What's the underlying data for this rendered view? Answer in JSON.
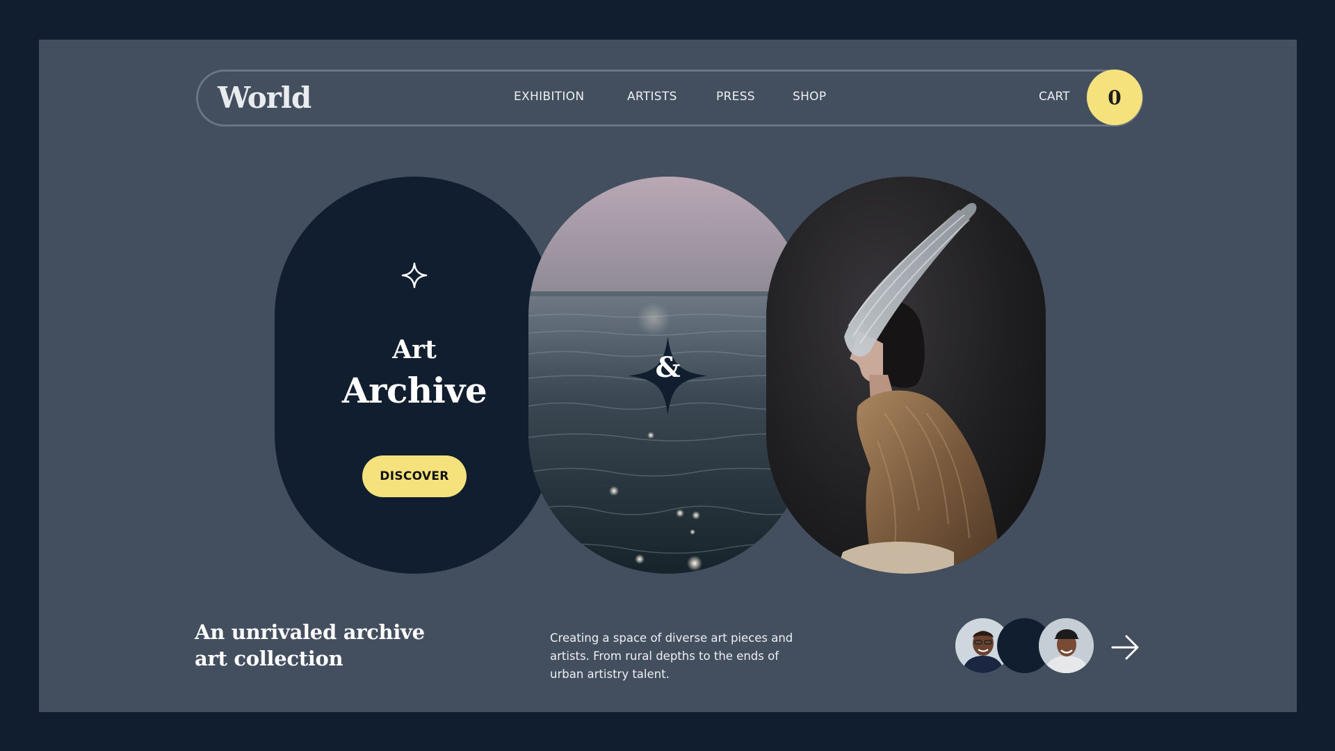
{
  "nav": {
    "logo": "World",
    "items": [
      {
        "label": "EXHIBITION"
      },
      {
        "label": "ARTISTS"
      },
      {
        "label": "PRESS"
      },
      {
        "label": "SHOP"
      }
    ],
    "cart_label": "CART",
    "cart_count": "0"
  },
  "hero": {
    "title_line1": "Art",
    "title_line2": "Archive",
    "cta_label": "DISCOVER",
    "ampersand": "&"
  },
  "footer": {
    "tagline_line1": "An unrivaled archive",
    "tagline_line2": "art collection",
    "description": "Creating a space of diverse art pieces and artists. From rural depths to the ends of urban artistry talent."
  },
  "colors": {
    "page_bg": "#101e30",
    "frame_bg": "#434f5f",
    "accent_yellow": "#f6e27c",
    "dark_navy": "#101e30"
  },
  "icons": {
    "sparkle": "four-point-star-outline-icon",
    "arrow": "arrow-right-icon"
  }
}
